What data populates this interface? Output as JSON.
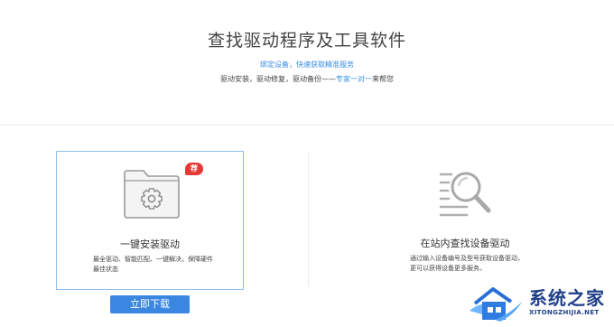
{
  "header": {
    "title": "查找驱动程序及工具软件",
    "bind_link": "绑定设备，快速获取精准服务",
    "subline_prefix": "驱动安装，驱动修复，驱动备份——",
    "subline_link": "专家一对一",
    "subline_suffix": "来帮您"
  },
  "cards": {
    "install": {
      "badge": "荐",
      "title": "一键安装驱动",
      "description": "最全驱动、智能匹配、一键解决，保障硬件最佳状态",
      "icon": "folder-gear-icon"
    },
    "search": {
      "title": "在站内查找设备驱动",
      "description": "通过输入设备编号及型号获取设备驱动，更可以获得设备更多服务。",
      "icon": "magnifier-list-icon"
    }
  },
  "buttons": {
    "download_now": "立即下载"
  },
  "watermark": {
    "name": "系统之家",
    "url": "XITONGZHIJIA.NET"
  },
  "colors": {
    "accent": "#3a86e0",
    "link": "#3a8ee6",
    "badge": "#e53935",
    "card_border": "#8fbfef",
    "watermark": "#1f3f8a"
  }
}
